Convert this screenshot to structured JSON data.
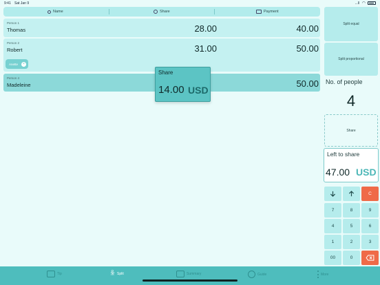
{
  "status": {
    "time": "9:41",
    "date": "Sat Jan 9",
    "signal": "...ll"
  },
  "header": {
    "name": "Name",
    "share": "Share",
    "payment": "Payment"
  },
  "persons": [
    {
      "label": "Person 1",
      "name": "Thomas",
      "share": "28.00",
      "payment": "40.00"
    },
    {
      "label": "Person 2",
      "name": "Robert",
      "share": "31.00",
      "payment": "50.00"
    },
    {
      "label": "Person 4",
      "name": "Madeleine",
      "share": "",
      "payment": "50.00"
    }
  ],
  "chip": {
    "label": "Anette",
    "close": "×"
  },
  "popover": {
    "title": "Share",
    "value": "14.00",
    "currency": "USD"
  },
  "right": {
    "split_equal": "Split equal",
    "split_proportional": "Split proportional",
    "people_label": "No. of people",
    "people_count": "4",
    "share_label": "Share",
    "left_label": "Left to share",
    "left_value": "47.00",
    "left_currency": "USD"
  },
  "keypad": {
    "clear": "C",
    "k7": "7",
    "k8": "8",
    "k9": "9",
    "k4": "4",
    "k5": "5",
    "k6": "6",
    "k1": "1",
    "k2": "2",
    "k3": "3",
    "k00": "00",
    "k0": "0"
  },
  "tabs": {
    "tip": "Tip",
    "split": "Split",
    "summary": "Summary",
    "guide": "Guide",
    "more": "More"
  },
  "colors": {
    "accent": "#4ebdbd",
    "clear": "#ef6a48",
    "row": "#c4f1f1",
    "active_row": "#8cd9d9"
  }
}
